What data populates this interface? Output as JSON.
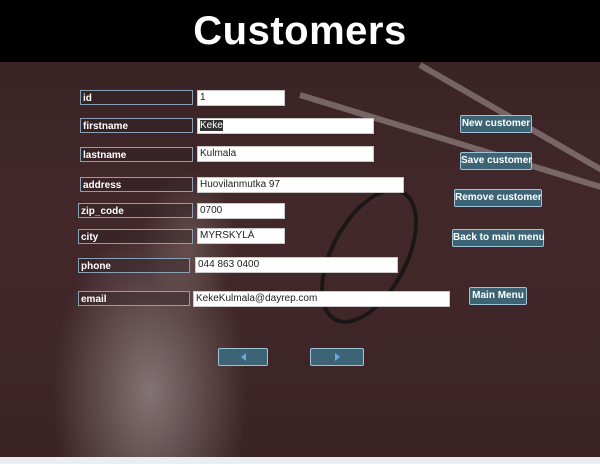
{
  "header": {
    "title": "Customers"
  },
  "form": {
    "id": {
      "label": "id",
      "value": "1"
    },
    "firstname": {
      "label": "firstname",
      "value_selected": "Keke",
      "value_rest": ""
    },
    "lastname": {
      "label": "lastname",
      "value": "Kulmala"
    },
    "address": {
      "label": "address",
      "value": "Huovilanmutka 97"
    },
    "zip_code": {
      "label": "zip_code",
      "value": "0700"
    },
    "city": {
      "label": "city",
      "value": "MYRSKYLÄ"
    },
    "phone": {
      "label": "phone",
      "value": "044 863 0400"
    },
    "email": {
      "label": "email",
      "value": "KekeKulmala@dayrep.com"
    }
  },
  "buttons": {
    "new_customer": "New customer",
    "save_customer": "Save customer",
    "remove_customer": "Remove customer",
    "back_to_main_menu": "Back to main menu",
    "main_menu": "Main Menu"
  },
  "nav": {
    "prev_icon": "arrow-left-icon",
    "next_icon": "arrow-right-icon",
    "accent_color": "#3d6474"
  }
}
